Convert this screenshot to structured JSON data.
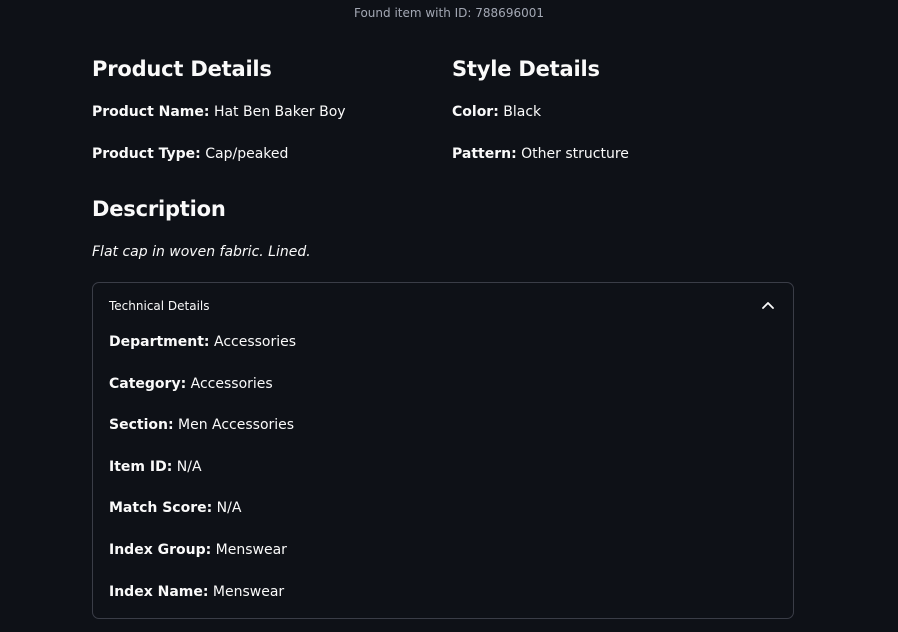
{
  "status": {
    "found_text": "Found item with ID: 788696001"
  },
  "product_details": {
    "heading": "Product Details",
    "name_label": "Product Name:",
    "name_value": "Hat Ben Baker Boy",
    "type_label": "Product Type:",
    "type_value": "Cap/peaked"
  },
  "style_details": {
    "heading": "Style Details",
    "color_label": "Color:",
    "color_value": "Black",
    "pattern_label": "Pattern:",
    "pattern_value": "Other structure"
  },
  "description": {
    "heading": "Description",
    "text": "Flat cap in woven fabric. Lined."
  },
  "technical_details": {
    "title": "Technical Details",
    "expanded": true,
    "toggle_icon": "chevron-up-icon",
    "fields": [
      {
        "label": "Department:",
        "value": "Accessories"
      },
      {
        "label": "Category:",
        "value": "Accessories"
      },
      {
        "label": "Section:",
        "value": "Men Accessories"
      },
      {
        "label": "Item ID:",
        "value": "N/A"
      },
      {
        "label": "Match Score:",
        "value": "N/A"
      },
      {
        "label": "Index Group:",
        "value": "Menswear"
      },
      {
        "label": "Index Name:",
        "value": "Menswear"
      }
    ]
  },
  "theme": {
    "background": "#0e1117",
    "text": "#fafafa",
    "muted_text": "#a3a8b4",
    "border": "#3a3d47"
  }
}
